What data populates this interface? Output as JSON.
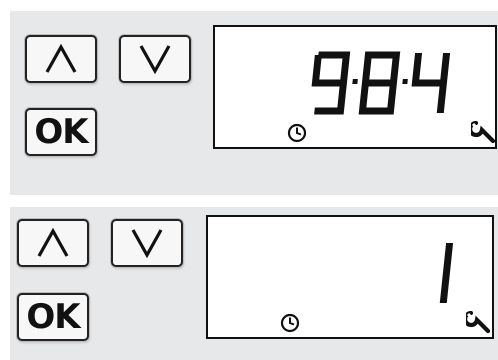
{
  "panels": [
    {
      "buttons": {
        "up": {
          "label": "∧",
          "icon": "chevron-up-icon"
        },
        "down": {
          "label": "∨",
          "icon": "chevron-down-icon"
        },
        "ok": {
          "label": "OK"
        }
      },
      "display": {
        "value": "9:8:4",
        "icons": [
          "clock-icon",
          "wrench-icon"
        ]
      }
    },
    {
      "buttons": {
        "up": {
          "label": "∧",
          "icon": "chevron-up-icon"
        },
        "down": {
          "label": "∨",
          "icon": "chevron-down-icon"
        },
        "ok": {
          "label": "OK"
        }
      },
      "display": {
        "value": "1",
        "icons": [
          "clock-icon",
          "wrench-icon"
        ]
      }
    }
  ],
  "colors": {
    "panel": "#e7e8ea",
    "ink": "#111111",
    "lcd": "#ffffff"
  }
}
